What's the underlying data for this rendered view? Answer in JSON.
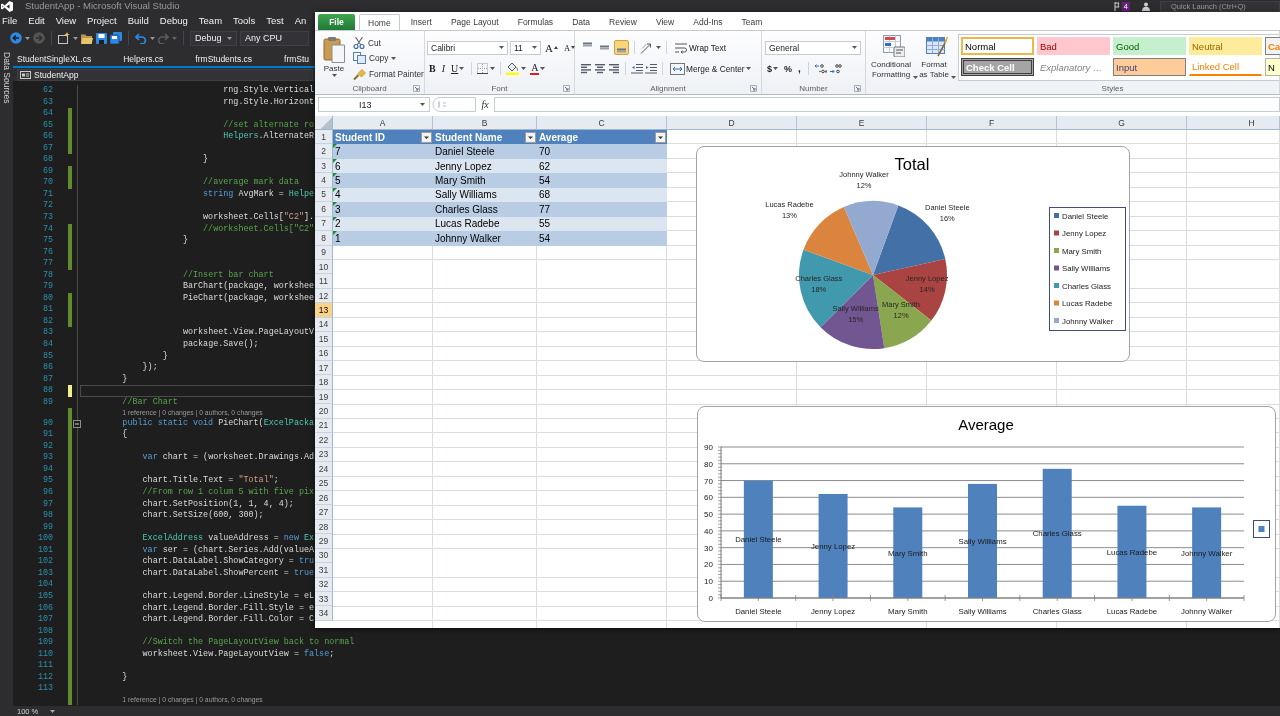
{
  "vs": {
    "title": "StudentApp - Microsoft Visual Studio",
    "notifications": "4",
    "quick_launch": {
      "placeholder": "Quick Launch (Ctrl+Q)"
    },
    "menu": [
      "File",
      "Edit",
      "View",
      "Project",
      "Build",
      "Debug",
      "Team",
      "Tools",
      "Test",
      "An"
    ],
    "toolbar": {
      "configuration": "Debug",
      "platform": "Any CPU"
    },
    "side_tab": "Data Sources",
    "doc_tabs": [
      {
        "label": "StudentSingleXL.cs",
        "selected": false
      },
      {
        "label": "Helpers.cs",
        "selected": false
      },
      {
        "label": "frmStudents.cs",
        "selected": false
      },
      {
        "label": "frmStu",
        "selected": false
      }
    ],
    "nav_project": "StudentApp",
    "lines": [
      {
        "kind": "code",
        "number": "62",
        "current": false,
        "tokens": [
          {
            "kind": "plain",
            "text": "                            rng.Style.Vertical"
          }
        ]
      },
      {
        "kind": "code",
        "number": "63",
        "current": false,
        "tokens": [
          {
            "kind": "plain",
            "text": "                            rng.Style.Horizont"
          }
        ]
      },
      {
        "kind": "code",
        "number": "64",
        "color": "#5f8a2e",
        "current": false
      },
      {
        "kind": "code",
        "number": "65",
        "color": "#5f8a2e",
        "current": false,
        "tokens": [
          {
            "kind": "comment",
            "text": "                            //set alternate ro"
          }
        ]
      },
      {
        "kind": "code",
        "number": "66",
        "color": "#5f8a2e",
        "current": false,
        "tokens": [
          {
            "kind": "type",
            "text": "                            Helpers"
          },
          {
            "kind": "plain",
            "text": ".AlternateR"
          }
        ]
      },
      {
        "kind": "code",
        "number": "67",
        "color": "#5f8a2e",
        "current": false
      },
      {
        "kind": "code",
        "number": "68",
        "current": false,
        "tokens": [
          {
            "kind": "plain",
            "text": "                        }"
          }
        ]
      },
      {
        "kind": "code",
        "number": "69",
        "color": "#5f8a2e",
        "current": false
      },
      {
        "kind": "code",
        "number": "70",
        "color": "#5f8a2e",
        "current": false,
        "tokens": [
          {
            "kind": "comment",
            "text": "                        //average mark data"
          }
        ]
      },
      {
        "kind": "code",
        "number": "71",
        "current": false,
        "tokens": [
          {
            "kind": "keyword",
            "text": "                        string"
          },
          {
            "kind": "plain",
            "text": " AvgMark = "
          },
          {
            "kind": "type",
            "text": "Helpe"
          }
        ]
      },
      {
        "kind": "code",
        "number": "72",
        "current": false
      },
      {
        "kind": "code",
        "number": "73",
        "current": false,
        "tokens": [
          {
            "kind": "plain",
            "text": "                        worksheet.Cells["
          },
          {
            "kind": "string",
            "text": "\"C2\""
          },
          {
            "kind": "plain",
            "text": "]."
          }
        ]
      },
      {
        "kind": "code",
        "number": "74",
        "color": "#5f8a2e",
        "current": false,
        "tokens": [
          {
            "kind": "comment",
            "text": "                        //worksheet.Cells[\"C2\""
          }
        ]
      },
      {
        "kind": "code",
        "number": "75",
        "color": "#5f8a2e",
        "current": false,
        "tokens": [
          {
            "kind": "plain",
            "text": "                    }"
          }
        ]
      },
      {
        "kind": "code",
        "number": "76",
        "color": "#5f8a2e",
        "current": false
      },
      {
        "kind": "code",
        "number": "77",
        "color": "#5f8a2e",
        "current": false
      },
      {
        "kind": "code",
        "number": "78",
        "current": false,
        "tokens": [
          {
            "kind": "comment",
            "text": "                    //Insert bar chart"
          }
        ]
      },
      {
        "kind": "code",
        "number": "79",
        "current": false,
        "tokens": [
          {
            "kind": "plain",
            "text": "                    BarChart(package, workshee"
          }
        ]
      },
      {
        "kind": "code",
        "number": "80",
        "color": "#5f8a2e",
        "current": false,
        "tokens": [
          {
            "kind": "plain",
            "text": "                    PieChart(package, workshee"
          }
        ]
      },
      {
        "kind": "code",
        "number": "81",
        "color": "#5f8a2e",
        "current": false
      },
      {
        "kind": "code",
        "number": "82",
        "color": "#5f8a2e",
        "current": false
      },
      {
        "kind": "code",
        "number": "83",
        "current": false,
        "tokens": [
          {
            "kind": "plain",
            "text": "                    worksheet.View.PageLayoutV"
          }
        ]
      },
      {
        "kind": "code",
        "number": "84",
        "current": false,
        "tokens": [
          {
            "kind": "plain",
            "text": "                    package.Save();"
          }
        ]
      },
      {
        "kind": "code",
        "number": "85",
        "current": false,
        "tokens": [
          {
            "kind": "plain",
            "text": "                }"
          }
        ]
      },
      {
        "kind": "code",
        "number": "86",
        "current": false,
        "tokens": [
          {
            "kind": "plain",
            "text": "            });"
          }
        ]
      },
      {
        "kind": "code",
        "number": "87",
        "current": false,
        "tokens": [
          {
            "kind": "plain",
            "text": "        }"
          }
        ]
      },
      {
        "kind": "code",
        "number": "88",
        "color": "#efef91",
        "current": true
      },
      {
        "kind": "code",
        "number": "89",
        "current": false,
        "tokens": [
          {
            "kind": "comment",
            "text": "        //Bar Chart"
          }
        ]
      },
      {
        "kind": "codelens",
        "color": "#5f8a2e",
        "text": "        1 reference | 0 changes | 0 authors, 0 changes"
      },
      {
        "kind": "code",
        "number": "90",
        "color": "#5f8a2e",
        "current": false,
        "fold": {
          "expanded": true
        },
        "tokens": [
          {
            "kind": "keyword",
            "text": "        public static void"
          },
          {
            "kind": "plain",
            "text": " PieChart("
          },
          {
            "kind": "type",
            "text": "ExcelPacka"
          }
        ]
      },
      {
        "kind": "code",
        "number": "91",
        "color": "#5f8a2e",
        "current": false,
        "tokens": [
          {
            "kind": "plain",
            "text": "        {"
          }
        ]
      },
      {
        "kind": "code",
        "number": "92",
        "color": "#5f8a2e",
        "current": false
      },
      {
        "kind": "code",
        "number": "93",
        "color": "#5f8a2e",
        "current": false,
        "tokens": [
          {
            "kind": "keyword",
            "text": "            var"
          },
          {
            "kind": "plain",
            "text": " chart = (worksheet.Drawings.Ad"
          }
        ]
      },
      {
        "kind": "code",
        "number": "94",
        "color": "#5f8a2e",
        "current": false
      },
      {
        "kind": "code",
        "number": "95",
        "color": "#5f8a2e",
        "current": false,
        "tokens": [
          {
            "kind": "plain",
            "text": "            chart.Title.Text = "
          },
          {
            "kind": "string",
            "text": "\"Total\""
          },
          {
            "kind": "plain",
            "text": ";"
          }
        ]
      },
      {
        "kind": "code",
        "number": "96",
        "color": "#5f8a2e",
        "current": false,
        "tokens": [
          {
            "kind": "comment",
            "text": "            //From row 1 colum 5 with five pix"
          }
        ]
      },
      {
        "kind": "code",
        "number": "97",
        "color": "#5f8a2e",
        "current": false,
        "tokens": [
          {
            "kind": "plain",
            "text": "            chart.SetPosition(1, 1, 4, 4);"
          }
        ]
      },
      {
        "kind": "code",
        "number": "98",
        "color": "#5f8a2e",
        "current": false,
        "tokens": [
          {
            "kind": "plain",
            "text": "            chart.SetSize(600, 300);"
          }
        ]
      },
      {
        "kind": "code",
        "number": "99",
        "color": "#5f8a2e",
        "current": false
      },
      {
        "kind": "code",
        "number": "100",
        "color": "#5f8a2e",
        "current": false,
        "tokens": [
          {
            "kind": "type",
            "text": "            ExcelAddress"
          },
          {
            "kind": "plain",
            "text": " valueAddress = "
          },
          {
            "kind": "keyword",
            "text": "new"
          },
          {
            "kind": "type",
            "text": " Ex"
          }
        ]
      },
      {
        "kind": "code",
        "number": "101",
        "color": "#5f8a2e",
        "current": false,
        "tokens": [
          {
            "kind": "keyword",
            "text": "            var"
          },
          {
            "kind": "plain",
            "text": " ser = (chart.Series.Add(valueA"
          }
        ]
      },
      {
        "kind": "code",
        "number": "102",
        "color": "#5f8a2e",
        "current": false,
        "tokens": [
          {
            "kind": "plain",
            "text": "            chart.DataLabel.ShowCategory = "
          },
          {
            "kind": "keyword",
            "text": "tru"
          }
        ]
      },
      {
        "kind": "code",
        "number": "103",
        "color": "#5f8a2e",
        "current": false,
        "tokens": [
          {
            "kind": "plain",
            "text": "            chart.DataLabel.ShowPercent = "
          },
          {
            "kind": "keyword",
            "text": "true"
          }
        ]
      },
      {
        "kind": "code",
        "number": "104",
        "color": "#5f8a2e",
        "current": false
      },
      {
        "kind": "code",
        "number": "105",
        "color": "#5f8a2e",
        "current": false,
        "tokens": [
          {
            "kind": "plain",
            "text": "            chart.Legend.Border.LineStyle = eL"
          }
        ]
      },
      {
        "kind": "code",
        "number": "106",
        "color": "#5f8a2e",
        "current": false,
        "tokens": [
          {
            "kind": "plain",
            "text": "            chart.Legend.Border.Fill.Style = e"
          }
        ]
      },
      {
        "kind": "code",
        "number": "107",
        "color": "#5f8a2e",
        "current": false,
        "tokens": [
          {
            "kind": "plain",
            "text": "            chart.Legend.Border.Fill.Color = C"
          }
        ]
      },
      {
        "kind": "code",
        "number": "108",
        "color": "#5f8a2e",
        "current": false
      },
      {
        "kind": "code",
        "number": "109",
        "color": "#5f8a2e",
        "current": false,
        "tokens": [
          {
            "kind": "comment",
            "text": "            //Switch the PageLayoutView back to normal"
          }
        ]
      },
      {
        "kind": "code",
        "number": "110",
        "color": "#5f8a2e",
        "current": false,
        "tokens": [
          {
            "kind": "plain",
            "text": "            worksheet.View.PageLayoutView = "
          },
          {
            "kind": "keyword",
            "text": "false"
          },
          {
            "kind": "plain",
            "text": ";"
          }
        ]
      },
      {
        "kind": "code",
        "number": "111",
        "color": "#5f8a2e",
        "current": false
      },
      {
        "kind": "code",
        "number": "112",
        "color": "#5f8a2e",
        "current": false,
        "tokens": [
          {
            "kind": "plain",
            "text": "        }"
          }
        ]
      },
      {
        "kind": "code",
        "number": "113",
        "color": "#5f8a2e",
        "current": false
      },
      {
        "kind": "codelens",
        "color": "#5f8a2e",
        "text": "        1 reference | 0 changes | 0 authors, 0 changes"
      }
    ],
    "zoom": "100 %"
  },
  "excel": {
    "ribbon_tabs": [
      {
        "label": "File",
        "kind": "backstage",
        "selected": false
      },
      {
        "label": "Home",
        "kind": "tab",
        "selected": true
      },
      {
        "label": "Insert",
        "kind": "tab",
        "selected": false
      },
      {
        "label": "Page Layout",
        "kind": "tab",
        "selected": false
      },
      {
        "label": "Formulas",
        "kind": "tab",
        "selected": false
      },
      {
        "label": "Data",
        "kind": "tab",
        "selected": false
      },
      {
        "label": "Review",
        "kind": "tab",
        "selected": false
      },
      {
        "label": "View",
        "kind": "tab",
        "selected": false
      },
      {
        "label": "Add-Ins",
        "kind": "tab",
        "selected": false
      },
      {
        "label": "Team",
        "kind": "tab",
        "selected": false
      }
    ],
    "clipboard": {
      "paste": "Paste",
      "cut": "Cut",
      "copy": "Copy",
      "format_painter": "Format Painter",
      "label": "Clipboard"
    },
    "font": {
      "name": "Calibri",
      "size": "11",
      "grow": "A",
      "shrink": "A",
      "bold": "B",
      "italic": "I",
      "underline": "U",
      "foreground": "A",
      "label": "Font"
    },
    "alignment": {
      "vertical": [
        {
          "kind": "top",
          "selected": false
        },
        {
          "kind": "middle",
          "selected": false
        },
        {
          "kind": "bottom",
          "selected": true
        }
      ],
      "wrap_text": "Wrap Text",
      "horizontal": [
        {
          "kind": "left",
          "selected": false
        },
        {
          "kind": "center",
          "selected": false
        },
        {
          "kind": "right",
          "selected": false
        }
      ],
      "merge": "Merge & Center",
      "label": "Alignment"
    },
    "number": {
      "format": "General",
      "currency": "$",
      "percent": "%",
      "comma": ",",
      "label": "Number"
    },
    "styles": {
      "conditional": "Conditional Formatting",
      "format_table": "Format as Table",
      "gallery": [
        {
          "label": "Normal",
          "kind": "normal",
          "selected": true
        },
        {
          "label": "Bad",
          "kind": "bad",
          "selected": false
        },
        {
          "label": "Good",
          "kind": "good",
          "selected": false
        },
        {
          "label": "Neutral",
          "kind": "neutral",
          "selected": false
        },
        {
          "label": "Ca",
          "kind": "calculation",
          "selected": false
        },
        {
          "label": "Check Cell",
          "kind": "check",
          "selected": false
        },
        {
          "label": "Explanatory …",
          "kind": "explanatory",
          "selected": false
        },
        {
          "label": "Input",
          "kind": "input",
          "selected": false
        },
        {
          "label": "Linked Cell",
          "kind": "linked",
          "selected": false
        },
        {
          "label": "N",
          "kind": "note",
          "selected": false
        }
      ],
      "label": "Styles"
    },
    "formula_bar": {
      "name_box": "I13",
      "function_label": "fx"
    },
    "sheet": {
      "columns": [
        {
          "label": "A",
          "selected": false
        },
        {
          "label": "B",
          "selected": false
        },
        {
          "label": "C",
          "selected": false
        },
        {
          "label": "D",
          "selected": false
        },
        {
          "label": "E",
          "selected": false
        },
        {
          "label": "F",
          "selected": false
        },
        {
          "label": "G",
          "selected": false
        },
        {
          "label": "H",
          "selected": false
        }
      ],
      "rows": [
        {
          "label": "1",
          "selected": false,
          "cells": [
            {
              "text": "Student ID",
              "kind": "header",
              "filter": true
            },
            {
              "text": "Student Name",
              "kind": "header",
              "filter": true
            },
            {
              "text": "Average",
              "kind": "header",
              "filter": true
            }
          ]
        },
        {
          "label": "2",
          "selected": false,
          "cells": [
            {
              "text": "7",
              "kind": "body",
              "flag": true
            },
            {
              "text": "Daniel Steele",
              "kind": "body",
              "flag": false
            },
            {
              "text": "70",
              "kind": "body",
              "flag": false
            }
          ]
        },
        {
          "label": "3",
          "selected": false,
          "cells": [
            {
              "text": "6",
              "kind": "body",
              "flag": true
            },
            {
              "text": "Jenny Lopez",
              "kind": "body",
              "flag": false
            },
            {
              "text": "62",
              "kind": "body",
              "flag": false
            }
          ]
        },
        {
          "label": "4",
          "selected": false,
          "cells": [
            {
              "text": "5",
              "kind": "body",
              "flag": true
            },
            {
              "text": "Mary Smith",
              "kind": "body",
              "flag": false
            },
            {
              "text": "54",
              "kind": "body",
              "flag": false
            }
          ]
        },
        {
          "label": "5",
          "selected": false,
          "cells": [
            {
              "text": "4",
              "kind": "body",
              "flag": true
            },
            {
              "text": "Sally Williams",
              "kind": "body",
              "flag": false
            },
            {
              "text": "68",
              "kind": "body",
              "flag": false
            }
          ]
        },
        {
          "label": "6",
          "selected": false,
          "cells": [
            {
              "text": "3",
              "kind": "body",
              "flag": true
            },
            {
              "text": "Charles Glass",
              "kind": "body",
              "flag": false
            },
            {
              "text": "77",
              "kind": "body",
              "flag": false
            }
          ]
        },
        {
          "label": "7",
          "selected": false,
          "cells": [
            {
              "text": "2",
              "kind": "body",
              "flag": true
            },
            {
              "text": "Lucas Radebe",
              "kind": "body",
              "flag": false
            },
            {
              "text": "55",
              "kind": "body",
              "flag": false
            }
          ]
        },
        {
          "label": "8",
          "selected": false,
          "cells": [
            {
              "text": "1",
              "kind": "body",
              "flag": true
            },
            {
              "text": "Johnny Walker",
              "kind": "body",
              "flag": false
            },
            {
              "text": "54",
              "kind": "body",
              "flag": false
            }
          ]
        },
        {
          "label": "9",
          "selected": false
        },
        {
          "label": "10",
          "selected": false
        },
        {
          "label": "11",
          "selected": false
        },
        {
          "label": "12",
          "selected": false
        },
        {
          "label": "13",
          "selected": true
        },
        {
          "label": "14",
          "selected": false
        },
        {
          "label": "15",
          "selected": false
        },
        {
          "label": "16",
          "selected": false
        },
        {
          "label": "17",
          "selected": false
        },
        {
          "label": "18",
          "selected": false
        },
        {
          "label": "19",
          "selected": false
        },
        {
          "label": "20",
          "selected": false
        },
        {
          "label": "21",
          "selected": false
        },
        {
          "label": "22",
          "selected": false
        },
        {
          "label": "23",
          "selected": false
        },
        {
          "label": "24",
          "selected": false
        },
        {
          "label": "25",
          "selected": false
        },
        {
          "label": "26",
          "selected": false
        },
        {
          "label": "27",
          "selected": false
        },
        {
          "label": "28",
          "selected": false
        },
        {
          "label": "29",
          "selected": false
        },
        {
          "label": "30",
          "selected": false
        },
        {
          "label": "31",
          "selected": false
        },
        {
          "label": "32",
          "selected": false
        },
        {
          "label": "33",
          "selected": false
        },
        {
          "label": "34",
          "selected": false
        }
      ]
    },
    "charts": [
      {
        "chart_data": {
          "type": "pie",
          "title": "Total",
          "categories": [
            "Daniel Steele",
            "Jenny Lopez",
            "Mary Smith",
            "Sally Williams",
            "Charles Glass",
            "Lucas Radebe",
            "Johnny Walker"
          ],
          "series": [
            {
              "values": [
                16,
                14,
                12,
                15,
                18,
                13,
                12
              ]
            }
          ],
          "colors": [
            "#4470a8",
            "#a94442",
            "#8aa64f",
            "#725691",
            "#4199ae",
            "#db843d",
            "#93a9d0"
          ],
          "legend": "right",
          "value_labels": [
            {
              "name": "Daniel Steele",
              "percent": "16%"
            },
            {
              "name": "Jenny Lopez",
              "percent": "14%"
            },
            {
              "name": "Mary Smith",
              "percent": "12%"
            },
            {
              "name": "Sally Williams",
              "percent": "15%"
            },
            {
              "name": "Charles Glass",
              "percent": "18%"
            },
            {
              "name": "Lucas Radebe",
              "percent": "13%"
            },
            {
              "name": "Johnny Walker",
              "percent": "12%"
            }
          ]
        }
      },
      {
        "chart_data": {
          "type": "bar",
          "title": "Average",
          "categories": [
            "Daniel Steele",
            "Jenny Lopez",
            "Mary Smith",
            "Sally Williams",
            "Charles Glass",
            "Lucas Radebe",
            "Johnny Walker"
          ],
          "series": [
            {
              "color": "#4f81bd",
              "values": [
                70,
                62,
                54,
                68,
                77,
                55,
                54
              ]
            }
          ],
          "ylim": [
            0,
            90
          ],
          "yticks": [
            0,
            10,
            20,
            30,
            40,
            50,
            60,
            70,
            80,
            90
          ],
          "grid": true,
          "value_labels": [
            "Daniel Steele",
            "Jenny Lopez",
            "Mary Smith",
            "Sally Williams",
            "Charles Glass",
            "Lucas Radebe",
            "Johnny Walker"
          ]
        }
      }
    ]
  }
}
